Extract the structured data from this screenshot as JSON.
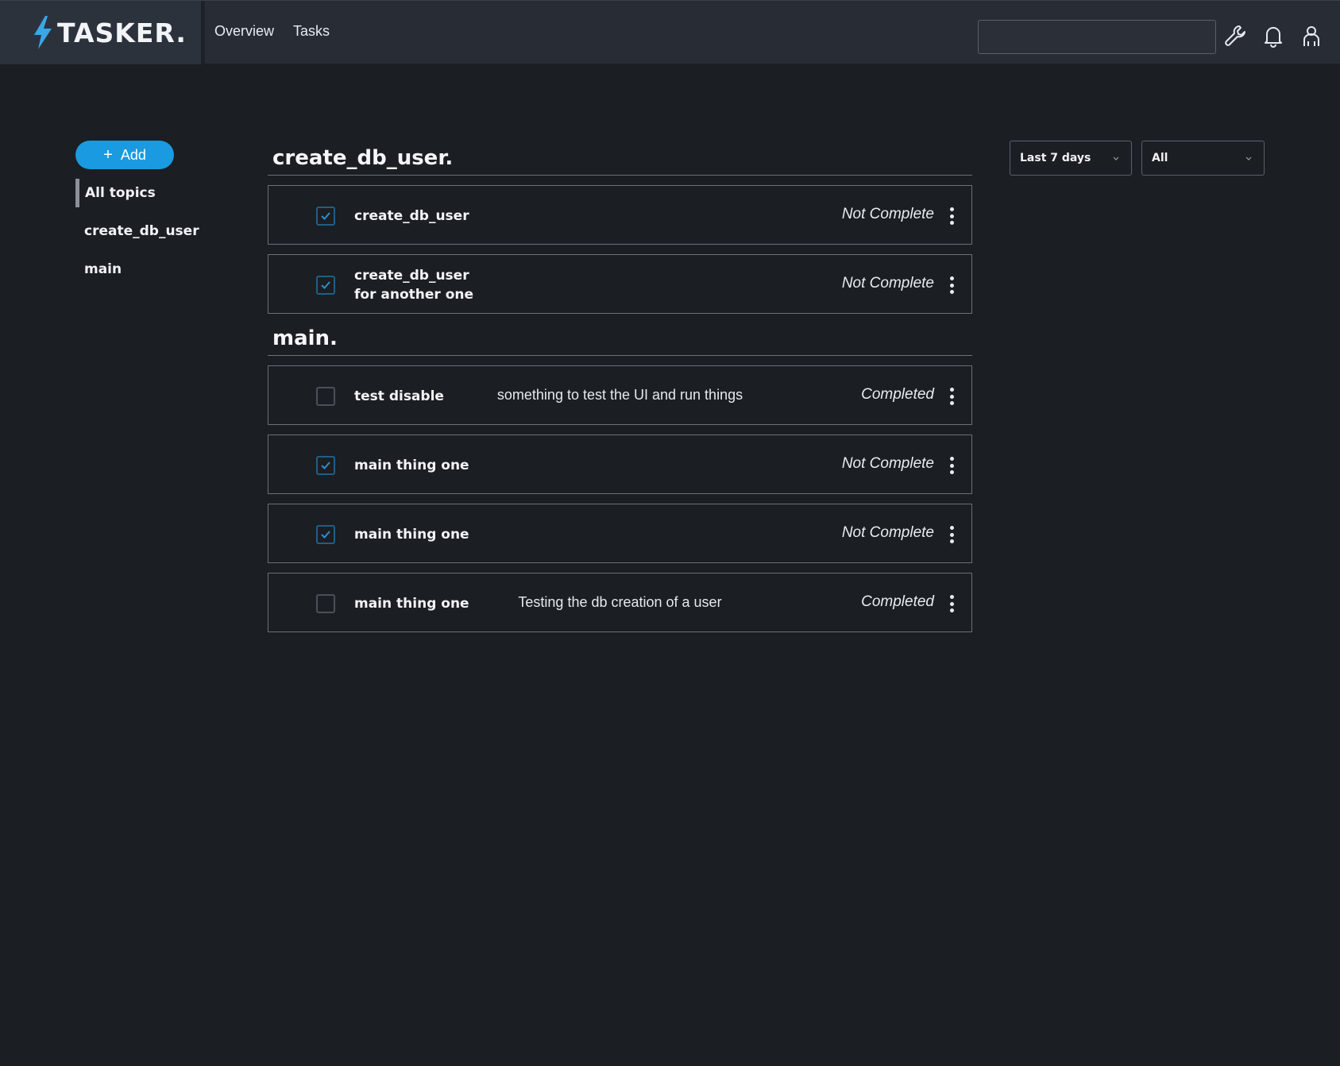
{
  "header": {
    "app_name": "TASKER.",
    "nav": [
      "Overview",
      "Tasks"
    ],
    "search": {
      "value": "",
      "placeholder": ""
    },
    "icons": [
      "wrench-icon",
      "bell-icon",
      "user-icon"
    ],
    "accent_color": "#1a9ae0"
  },
  "sidebar": {
    "add_label": "Add",
    "items": [
      {
        "label": "All topics",
        "active": true
      },
      {
        "label": "create_db_user",
        "active": false
      },
      {
        "label": "main",
        "active": false
      }
    ]
  },
  "filters": {
    "range": "Last 7 days",
    "status": "All"
  },
  "groups": [
    {
      "title": "create_db_user.",
      "tasks": [
        {
          "name_lines": [
            "create_db_user"
          ],
          "description": "",
          "status": "Not Complete",
          "checked": true
        },
        {
          "name_lines": [
            "create_db_user",
            "for another one"
          ],
          "description": "",
          "status": "Not Complete",
          "checked": true
        }
      ]
    },
    {
      "title": "main.",
      "tasks": [
        {
          "name_lines": [
            "test disable"
          ],
          "description": "something to test the UI and run things",
          "status": "Completed",
          "checked": false
        },
        {
          "name_lines": [
            "main thing one"
          ],
          "description": "",
          "status": "Not Complete",
          "checked": true
        },
        {
          "name_lines": [
            "main thing one"
          ],
          "description": "",
          "status": "Not Complete",
          "checked": true
        },
        {
          "name_lines": [
            "main thing one"
          ],
          "description": "Testing the db creation of a user",
          "status": "Completed",
          "checked": false
        }
      ]
    }
  ]
}
